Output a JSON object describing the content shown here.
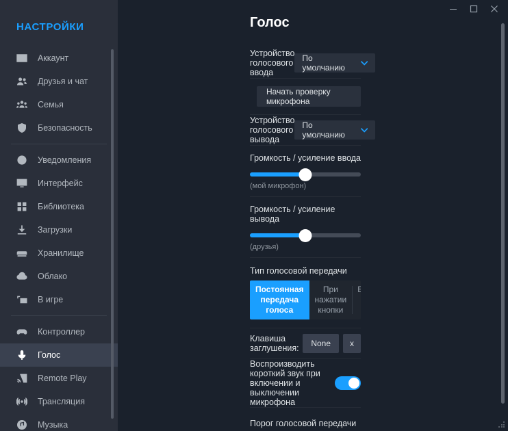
{
  "window": {
    "controls": [
      {
        "name": "minimize",
        "glyph": "minimize-icon"
      },
      {
        "name": "maximize",
        "glyph": "maximize-icon"
      },
      {
        "name": "close",
        "glyph": "close-icon"
      }
    ]
  },
  "sidebar": {
    "title": "НАСТРОЙКИ",
    "items": [
      {
        "label": "Аккаунт",
        "icon": "account-card-icon",
        "active": false,
        "sep_after": false
      },
      {
        "label": "Друзья и чат",
        "icon": "friends-icon",
        "active": false,
        "sep_after": false
      },
      {
        "label": "Семья",
        "icon": "family-icon",
        "active": false,
        "sep_after": false
      },
      {
        "label": "Безопасность",
        "icon": "shield-icon",
        "active": false,
        "sep_after": true
      },
      {
        "label": "Уведомления",
        "icon": "bell-alert-icon",
        "active": false,
        "sep_after": false
      },
      {
        "label": "Интерфейс",
        "icon": "monitor-icon",
        "active": false,
        "sep_after": false
      },
      {
        "label": "Библиотека",
        "icon": "grid-icon",
        "active": false,
        "sep_after": false
      },
      {
        "label": "Загрузки",
        "icon": "download-icon",
        "active": false,
        "sep_after": false
      },
      {
        "label": "Хранилище",
        "icon": "drive-icon",
        "active": false,
        "sep_after": false
      },
      {
        "label": "Облако",
        "icon": "cloud-icon",
        "active": false,
        "sep_after": false
      },
      {
        "label": "В игре",
        "icon": "in-game-icon",
        "active": false,
        "sep_after": true
      },
      {
        "label": "Контроллер",
        "icon": "gamepad-icon",
        "active": false,
        "sep_after": false
      },
      {
        "label": "Голос",
        "icon": "microphone-icon",
        "active": true,
        "sep_after": false
      },
      {
        "label": "Remote Play",
        "icon": "cast-icon",
        "active": false,
        "sep_after": false
      },
      {
        "label": "Трансляция",
        "icon": "broadcast-icon",
        "active": false,
        "sep_after": false
      },
      {
        "label": "Музыка",
        "icon": "music-note-icon",
        "active": false,
        "sep_after": false
      }
    ]
  },
  "page": {
    "title": "Голос"
  },
  "voice": {
    "input_device": {
      "label": "Устройство голосового ввода",
      "value": "По умолчанию"
    },
    "mic_test": {
      "button_label": "Начать проверку микрофона",
      "level_percent": 0
    },
    "output_device": {
      "label": "Устройство голосового вывода",
      "value": "По умолчанию"
    },
    "input_volume": {
      "label": "Громкость / усиление ввода",
      "hint": "(мой микрофон)",
      "value_percent": 50
    },
    "output_volume": {
      "label": "Громкость / усиление вывода",
      "hint": "(друзья)",
      "value_percent": 50
    },
    "transmission": {
      "label": "Тип голосовой передачи",
      "options": [
        {
          "label": "Постоянная передача голоса",
          "active": true
        },
        {
          "label": "При нажатии кнопки",
          "active": false
        },
        {
          "label": "Выключение звука при нажатии",
          "active": false
        }
      ]
    },
    "mute_key": {
      "label": "Клавиша заглушения:",
      "value": "None",
      "clear_label": "x"
    },
    "mic_sound": {
      "label": "Воспроизводить короткий звук при включении и выключении микрофона",
      "enabled": true
    },
    "threshold": {
      "label": "Порог голосовой передачи"
    }
  },
  "colors": {
    "accent": "#1a9fff",
    "sidebar_bg": "#2a2f3a",
    "main_bg": "#1a212c",
    "active_item_bg": "#3a4150",
    "text_primary": "#dfe3e6",
    "text_muted": "#8d949c"
  }
}
